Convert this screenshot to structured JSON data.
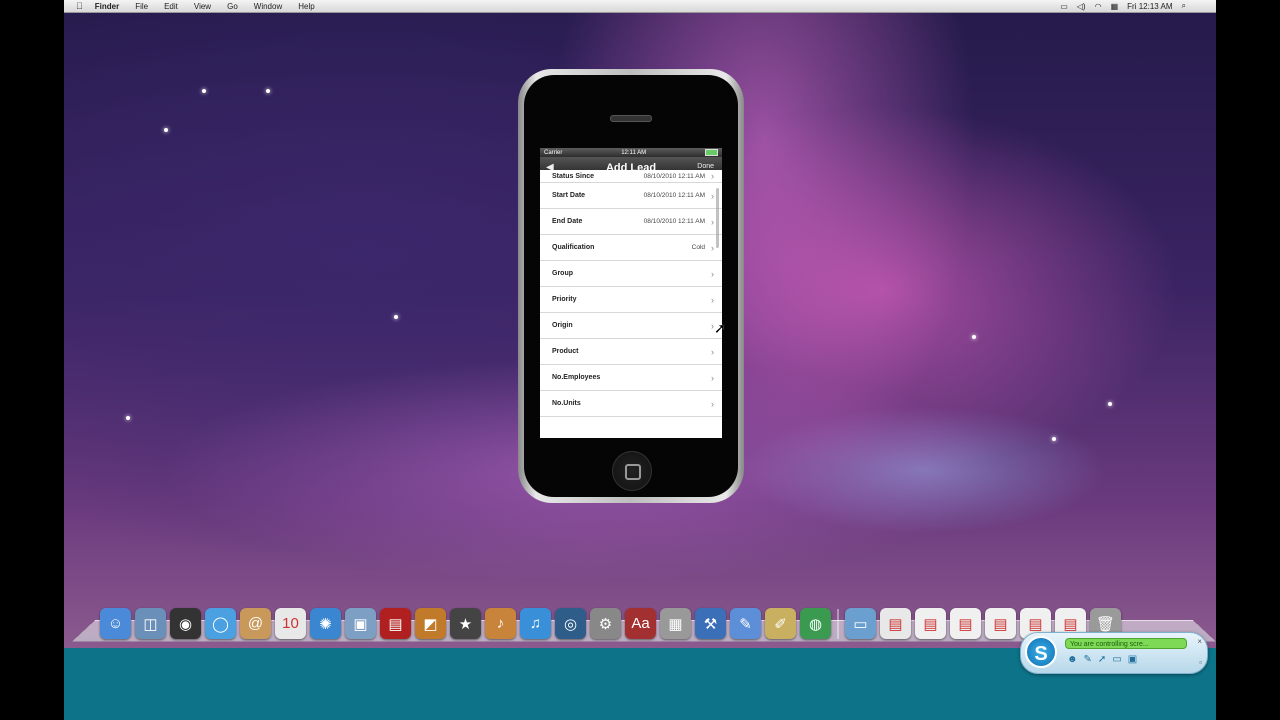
{
  "menubar": {
    "apple_icon": "apple-icon",
    "items": [
      "Finder",
      "File",
      "Edit",
      "View",
      "Go",
      "Window",
      "Help"
    ],
    "clock": "Fri 12:13 AM"
  },
  "iphone": {
    "carrier": "Carrier",
    "time": "12:11 AM",
    "title": "Add Lead",
    "back_icon": "back-arrow-icon",
    "done_label": "Done",
    "rows": [
      {
        "label": "Status Since",
        "value": "08/10/2010 12:11 AM"
      },
      {
        "label": "Start Date",
        "value": "08/10/2010 12:11 AM"
      },
      {
        "label": "End Date",
        "value": "08/10/2010 12:11 AM"
      },
      {
        "label": "Qualification",
        "value": "Cold"
      },
      {
        "label": "Group",
        "value": ""
      },
      {
        "label": "Priority",
        "value": ""
      },
      {
        "label": "Origin",
        "value": ""
      },
      {
        "label": "Product",
        "value": ""
      },
      {
        "label": "No.Employees",
        "value": ""
      },
      {
        "label": "No.Units",
        "value": ""
      }
    ],
    "chevron": "›"
  },
  "dock": {
    "apps": [
      {
        "name": "finder-icon",
        "color": "#4a8ad8",
        "glyph": "☺"
      },
      {
        "name": "preview-icon",
        "color": "#6a8fb8",
        "glyph": "◫"
      },
      {
        "name": "dashboard-icon",
        "color": "#333333",
        "glyph": "◉"
      },
      {
        "name": "ichat-icon",
        "color": "#4aa0e0",
        "glyph": "◯"
      },
      {
        "name": "address-book-icon",
        "color": "#c8995a",
        "glyph": "@"
      },
      {
        "name": "ical-icon",
        "color": "#e8e8e8",
        "glyph": "10"
      },
      {
        "name": "safari-icon",
        "color": "#3a86d0",
        "glyph": "✺"
      },
      {
        "name": "iphoto-icon",
        "color": "#7d9fc4",
        "glyph": "▣"
      },
      {
        "name": "photo-booth-icon",
        "color": "#b02020",
        "glyph": "▤"
      },
      {
        "name": "image-capture-icon",
        "color": "#c07a2a",
        "glyph": "◩"
      },
      {
        "name": "imovie-icon",
        "color": "#444444",
        "glyph": "★"
      },
      {
        "name": "garageband-icon",
        "color": "#c8843a",
        "glyph": "♪"
      },
      {
        "name": "itunes-icon",
        "color": "#3a90d8",
        "glyph": "♫"
      },
      {
        "name": "time-machine-icon",
        "color": "#2f5d8a",
        "glyph": "◎"
      },
      {
        "name": "system-preferences-icon",
        "color": "#888888",
        "glyph": "⚙"
      },
      {
        "name": "dictionary-icon",
        "color": "#a33030",
        "glyph": "Aa"
      },
      {
        "name": "utility-icon",
        "color": "#999999",
        "glyph": "▦"
      },
      {
        "name": "xcode-icon",
        "color": "#3b6fb8",
        "glyph": "⚒"
      },
      {
        "name": "interface-builder-icon",
        "color": "#5c8fd8",
        "glyph": "✎"
      },
      {
        "name": "instruments-icon",
        "color": "#c8b060",
        "glyph": "✐"
      },
      {
        "name": "globe-icon",
        "color": "#3a9a50",
        "glyph": "◍"
      }
    ],
    "stacks": [
      {
        "name": "applications-folder-icon",
        "color": "#6a9fd0",
        "glyph": "▭"
      },
      {
        "name": "document-stack-icon",
        "color": "#e8e8e8",
        "glyph": "▤"
      },
      {
        "name": "document-stack-icon",
        "color": "#f0f0f0",
        "glyph": "▤"
      },
      {
        "name": "document-stack-icon",
        "color": "#f0f0f0",
        "glyph": "▤"
      },
      {
        "name": "document-stack-icon",
        "color": "#f0f0f0",
        "glyph": "▤"
      },
      {
        "name": "document-stack-icon",
        "color": "#f0f0f0",
        "glyph": "▤"
      },
      {
        "name": "document-stack-icon",
        "color": "#f0f0f0",
        "glyph": "▤"
      },
      {
        "name": "trash-icon",
        "color": "#9a9a9a",
        "glyph": "🗑"
      }
    ]
  },
  "skype": {
    "message": "You are controlling scre...",
    "close": "×",
    "minimize": "▫"
  },
  "colors": {
    "bottom_bar": "#0d7388",
    "skype_message_bg": "#7ed957"
  }
}
